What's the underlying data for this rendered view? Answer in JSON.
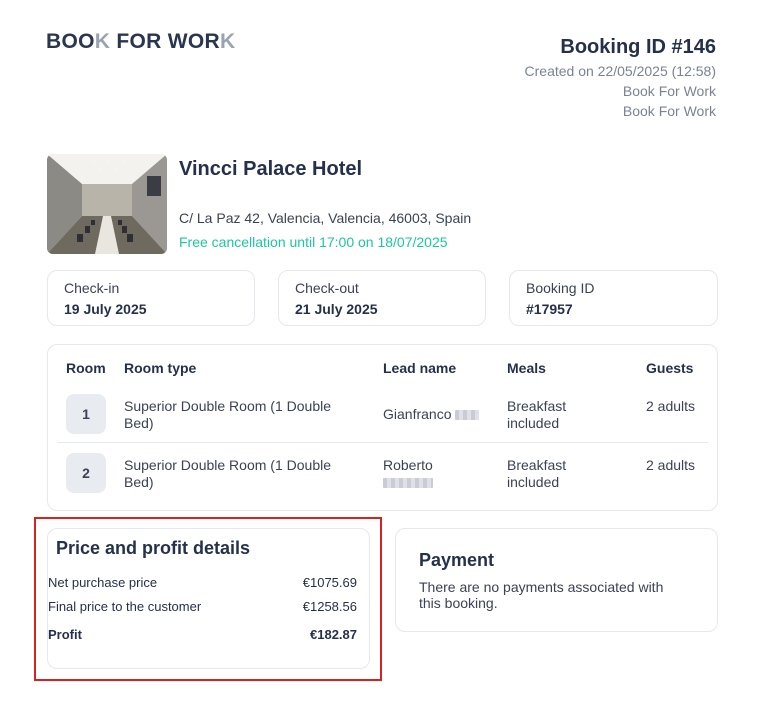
{
  "header": {
    "logo_part1": "BOO",
    "logo_k": "K",
    "logo_part2": " FOR WOR",
    "logo_k2": "K",
    "booking_title": "Booking ID #146",
    "created": "Created on 22/05/2025 (12:58)",
    "agency_line1": "Book For Work",
    "agency_line2": "Book For Work"
  },
  "hotel": {
    "name": "Vincci Palace Hotel",
    "address": "C/ La Paz 42, Valencia, Valencia, 46003, Spain",
    "cancellation": "Free cancellation until 17:00 on 18/07/2025"
  },
  "info_cards": [
    {
      "label": "Check-in",
      "value": "19 July 2025"
    },
    {
      "label": "Check-out",
      "value": "21 July 2025"
    },
    {
      "label": "Booking ID",
      "value": "#17957"
    }
  ],
  "rooms_table": {
    "headers": [
      "Room",
      "Room type",
      "Lead name",
      "Meals",
      "Guests"
    ],
    "rows": [
      {
        "room": "1",
        "type": "Superior Double Room (1 Double Bed)",
        "lead": "Gianfranco",
        "meals": "Breakfast included",
        "guests": "2 adults"
      },
      {
        "room": "2",
        "type": "Superior Double Room (1 Double Bed)",
        "lead": "Roberto",
        "meals": "Breakfast included",
        "guests": "2 adults"
      }
    ]
  },
  "price": {
    "title": "Price and profit details",
    "net_label": "Net purchase price",
    "net_value": "€1075.69",
    "final_label": "Final price to the customer",
    "final_value": "€1258.56",
    "profit_label": "Profit",
    "profit_value": "€182.87"
  },
  "payment": {
    "title": "Payment",
    "text": "There are no payments associated with this booking."
  },
  "colors": {
    "brand": "#2a3650",
    "accent_green": "#1ec6a0",
    "highlight_red": "#d62222"
  }
}
